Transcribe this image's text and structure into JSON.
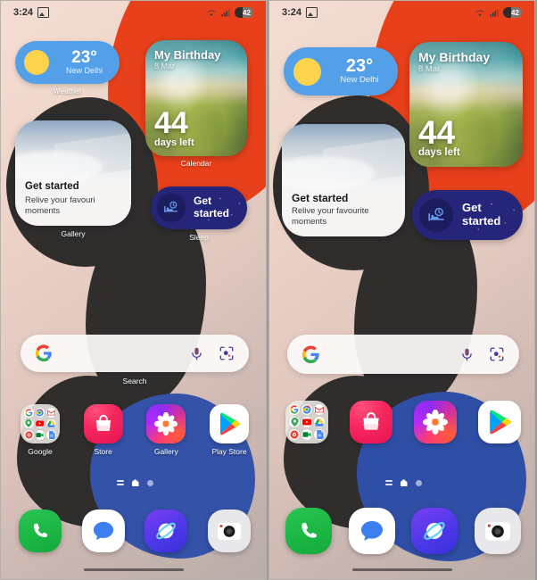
{
  "status_bar": {
    "time": "3:24",
    "screenshot_icon": "image-icon",
    "wifi_icon": "wifi-icon",
    "signal_icon": "cellular-signal-icon",
    "battery_level": "42"
  },
  "panels": [
    {
      "id": "left-panel",
      "shows_widget_labels": true,
      "widgets": {
        "weather": {
          "temperature": "23°",
          "location": "New Delhi",
          "icon": "sun-icon",
          "label": "Weather"
        },
        "calendar": {
          "title": "My Birthday",
          "date": "8 Mar",
          "days_number": "44",
          "days_text": "days left",
          "label": "Calendar"
        },
        "gallery": {
          "heading": "Get started",
          "subtext": "Relive your favouri moments",
          "label": "Gallery"
        },
        "sleep": {
          "button_label": "Get started",
          "icon": "bed-clock-icon",
          "label": "Sleep"
        }
      },
      "search": {
        "google_icon": "google-g-icon",
        "mic_icon": "microphone-icon",
        "lens_icon": "google-lens-icon",
        "label": "Search"
      },
      "apps": [
        {
          "name": "Google",
          "icon": "google-folder-icon"
        },
        {
          "name": "Store",
          "icon": "galaxy-store-icon"
        },
        {
          "name": "Gallery",
          "icon": "gallery-flower-icon"
        },
        {
          "name": "Play Store",
          "icon": "play-store-icon"
        }
      ],
      "dock": [
        {
          "name": "Phone",
          "icon": "phone-icon"
        },
        {
          "name": "Messages",
          "icon": "messages-icon"
        },
        {
          "name": "Internet",
          "icon": "internet-browser-icon"
        },
        {
          "name": "Camera",
          "icon": "camera-icon"
        }
      ],
      "page_indicator": {
        "apps_list_icon": "app-list-icon",
        "home_icon": "home-icon",
        "page_dot": "page-dot"
      },
      "nav_bar": "home-gesture-bar"
    },
    {
      "id": "right-panel",
      "shows_widget_labels": false,
      "widgets": {
        "weather": {
          "temperature": "23°",
          "location": "New Delhi",
          "icon": "sun-icon",
          "label": ""
        },
        "calendar": {
          "title": "My Birthday",
          "date": "8 Mar",
          "days_number": "44",
          "days_text": "days left",
          "label": ""
        },
        "gallery": {
          "heading": "Get started",
          "subtext": "Relive your favourite moments",
          "label": ""
        },
        "sleep": {
          "button_label": "Get started",
          "icon": "bed-clock-icon",
          "label": ""
        }
      },
      "search": {
        "google_icon": "google-g-icon",
        "mic_icon": "microphone-icon",
        "lens_icon": "google-lens-icon",
        "label": ""
      },
      "apps": [
        {
          "name": "",
          "icon": "google-folder-icon"
        },
        {
          "name": "",
          "icon": "galaxy-store-icon"
        },
        {
          "name": "",
          "icon": "gallery-flower-icon"
        },
        {
          "name": "",
          "icon": "play-store-icon"
        }
      ],
      "dock": [
        {
          "name": "Phone",
          "icon": "phone-icon"
        },
        {
          "name": "Messages",
          "icon": "messages-icon"
        },
        {
          "name": "Internet",
          "icon": "internet-browser-icon"
        },
        {
          "name": "Camera",
          "icon": "camera-icon"
        }
      ],
      "page_indicator": {
        "apps_list_icon": "app-list-icon",
        "home_icon": "home-icon",
        "page_dot": "page-dot"
      },
      "nav_bar": "home-gesture-bar"
    }
  ],
  "folder_mini_apps": [
    "Google",
    "Chrome",
    "Gmail",
    "Maps",
    "YouTube",
    "Drive",
    "Photos",
    "Meet",
    "Docs"
  ],
  "colors": {
    "wallpaper_orange": "#e8401a",
    "wallpaper_black": "#302e2d",
    "wallpaper_blue": "#3352a8",
    "weather_widget": "#54a0e8",
    "sleep_widget": "#25267a",
    "search_bar": "#fcfaf9"
  }
}
